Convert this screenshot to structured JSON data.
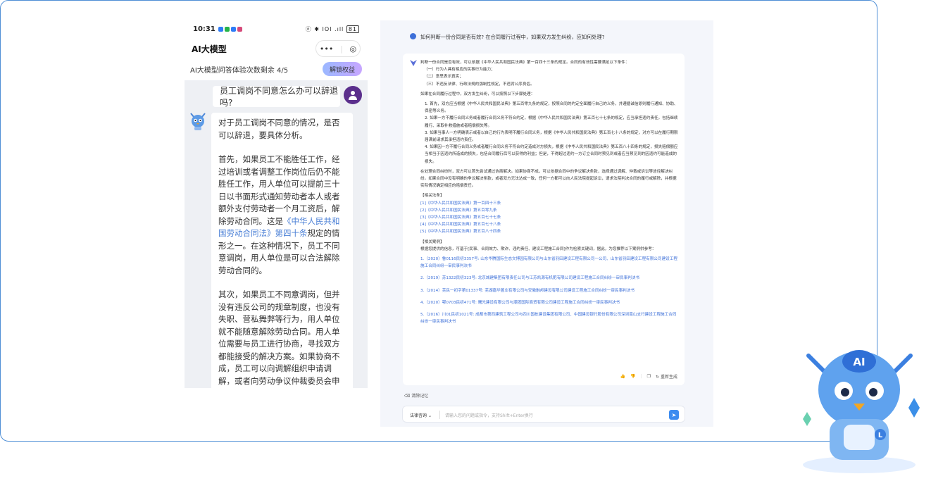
{
  "phone": {
    "status": {
      "time": "10:31",
      "icons": "ⓝ ✱ ⅠOⅠ .ıll ",
      "battery": "81"
    },
    "title": "AI大模型",
    "capsule": {
      "more": "•••",
      "close": "◎"
    },
    "quota_text": "AI大模型问答体验次数剩余 4/5",
    "unlock_label": "解锁权益",
    "user_message": "员工调岗不同意怎么办可以辞退吗?",
    "answer": {
      "p1": "对于员工调岗不同意的情况，是否可以辞退，要具体分析。",
      "p2_before": "首先，如果员工不能胜任工作，经过培训或者调整工作岗位后仍不能胜任工作，用人单位可以提前三十日以书面形式通知劳动者本人或者额外支付劳动者一个月工资后，解除劳动合同。这是",
      "p2_link": "《中华人民共和国劳动合同法》第四十条",
      "p2_after": "规定的情形之一。在这种情况下，员工不同意调岗，用人单位是可以合法解除劳动合同的。",
      "p3": "其次，如果员工不同意调岗，但并没有违反公司的规章制度，也没有失职、营私舞弊等行为，用人单位就不能随意解除劳动合同。用人单位需要与员工进行协商，寻找双方都能接受的解决方案。如果协商不成，员工可以向调解组织申请调解，或者向劳动争议仲裁委员会申请仲裁。如果仲裁裁决不服，员工可以向人民法院提起诉讼。"
    }
  },
  "desktop": {
    "question": "如何判断一份合同是否有效? 在合同履行过程中，如果双方发生纠纷，应如何处理?",
    "intro": "判断一份合同是否有效，可以依据《中华人民共和国民法典》第一百四十三条的规定。合同的有效性需要满足以下条件：",
    "conditions": [
      "（一）行为人具有相应的民事行为能力；",
      "（二）意思表示真实；",
      "（三）不违反法律、行政法规的强制性规定，不违背公序良俗。"
    ],
    "dispute_intro": "如果在合同履行过程中，双方发生纠纷，可以按照以下步骤处理：",
    "steps": [
      "1. 首先，双方应当根据《中华人民共和国民法典》第五百零九条的规定，按照合同的约定全面履行自己的义务，并遵循诚信原则履行通知、协助、保密等义务。",
      "2. 如果一方不履行合同义务或者履行合同义务不符合约定，根据《中华人民共和国民法典》第五百七十七条的规定，应当承担违约责任，包括继续履行、采取补救措施或者赔偿损失等。",
      "3. 如果当事人一方明确表示或者以自己的行为表明不履行合同义务，根据《中华人民共和国民法典》第五百七十八条的规定，对方可以在履行期限届满前请求其承担违约责任。",
      "4. 如果因一方不履行合同义务或者履行合同义务不符合约定造成对方损失，根据《中华人民共和国民法典》第五百八十四条的规定，损失赔偿额应当相当于因违约所造成的损失，包括合同履行后可以获得的利益；但是，不得超过违约一方订立合同时预见到或者应当预见到的因违约可能造成的损失。"
    ],
    "conclusion": "在处理合同纠纷时，双方可以首先尝试通过协商解决。如果协商不成，可以依据合同中的争议解决条款，选择通过调解、仲裁或诉讼等途径解决纠纷。如果合同中没有明确的争议解决条款，或者双方无法达成一致，任何一方都可以向人民法院提起诉讼，请求法院判决合同的履行或解除，并根据实际情况确定相应的赔偿责任。",
    "laws_title": "【相关法条】",
    "laws": [
      "[1]《中华人民共和国民法典》第一百四十三条",
      "[2]《中华人民共和国民法典》第五百零九条",
      "[3]《中华人民共和国民法典》第五百七十七条",
      "[4]《中华人民共和国民法典》第五百七十八条",
      "[5]《中华人民共和国民法典》第五百八十四条"
    ],
    "cases_title": "【相关案例】",
    "cases_intro": "根据您提供的信息，可基于[民事、合同效力、欺诈、违约责任、建设工程施工合同]作为检索关键词，据此，为您推荐以下案例供参考：",
    "cases": [
      "1.（2020）鲁0116民初3357号: 山东华腾国际生态文博园有限公司与山东省羽田建设工程有限公司一公司、山东省羽田建设工程有限公司建设工程施工合同纠纷一审民事判决书",
      "2.（2019）苏1322民初323号: 北京城建集团有限责任公司与江苏凯源有机肥有限公司建设工程施工合同纠纷一审民事判决书",
      "3.（2014）芜民一初字第01337号: 芜湖嘉华置业有限公司与安徽融邦建设有限公司建设工程施工合同纠纷一审民事判决书",
      "4.（2020）鄂0703民初471号: 曙光建设有限公司与潮团国际商贸有限公司建设工程施工合同纠纷一审民事判决书",
      "5.（2016）川01民初1021号: 成都市第四建筑工程公司与四川国栋建设集团有限公司、中国建设银行股份有限公司深圳南山支行建设工程施工合同纠纷一审民事判决书"
    ],
    "regenerate_label": "重新生成",
    "clear_memory_label": "清除记忆",
    "mode_label": "法律咨询",
    "input_placeholder": "请输入您的问题或指令，支持Shift+Enter换行"
  },
  "robot": {
    "badge": "AI"
  },
  "colors": {
    "frame_border": "#4f8fd6",
    "link": "#3c6fd8",
    "send": "#3c8cf0"
  }
}
